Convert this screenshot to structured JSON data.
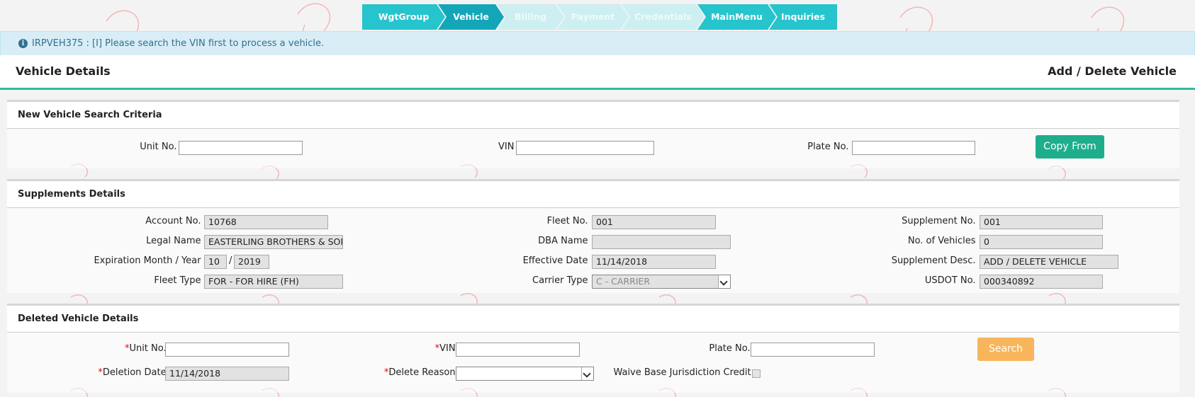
{
  "wizard": {
    "steps": [
      {
        "label": "WgtGroup",
        "state": "done"
      },
      {
        "label": "Vehicle",
        "state": "active"
      },
      {
        "label": "Billing",
        "state": "disabled"
      },
      {
        "label": "Payment",
        "state": "disabled"
      },
      {
        "label": "Credentials",
        "state": "disabled"
      },
      {
        "label": "MainMenu",
        "state": "done"
      },
      {
        "label": "Inquiries",
        "state": "done"
      }
    ]
  },
  "alert": {
    "icon": "info-icon",
    "message": "IRPVEH375 : [I] Please search the VIN first to process a vehicle."
  },
  "title": {
    "left": "Vehicle Details",
    "right": "Add / Delete Vehicle"
  },
  "search": {
    "heading": "New Vehicle Search Criteria",
    "unit_label": "Unit No. :",
    "unit_value": "",
    "vin_label": "VIN :",
    "vin_value": "",
    "plate_label": "Plate No. :",
    "plate_value": "",
    "copy_button": "Copy From"
  },
  "supplements": {
    "heading": "Supplements Details",
    "account_label": "Account No. :",
    "account_value": "10768",
    "fleet_label": "Fleet No. :",
    "fleet_value": "001",
    "supno_label": "Supplement No. :",
    "supno_value": "001",
    "legal_label": "Legal Name :",
    "legal_value": "EASTERLING BROTHERS & SON",
    "dba_label": "DBA Name :",
    "dba_value": "",
    "nveh_label": "No. of Vehicles :",
    "nveh_value": "0",
    "exp_label": "Expiration Month / Year :",
    "exp_month": "10",
    "exp_sep": "/",
    "exp_year": "2019",
    "eff_label": "Effective Date :",
    "eff_value": "11/14/2018",
    "supdesc_label": "Supplement Desc. :",
    "supdesc_value": "ADD / DELETE VEHICLE",
    "fleettype_label": "Fleet Type :",
    "fleettype_value": "FOR - FOR HIRE (FH)",
    "carrier_label": "Carrier Type :",
    "carrier_value": "C - CARRIER",
    "usdot_label": "USDOT No. :",
    "usdot_value": "000340892"
  },
  "deleted": {
    "heading": "Deleted Vehicle Details",
    "required_mark": "*",
    "unit_label": "Unit No.:",
    "unit_value": "",
    "vin_label": "VIN:",
    "vin_value": "",
    "plate_label": "Plate No.:",
    "plate_value": "",
    "search_button": "Search",
    "deldate_label": "Deletion Date:",
    "deldate_value": "11/14/2018",
    "reason_label": "Delete Reason:",
    "reason_value": "",
    "waive_label": "Waive Base Jurisdiction Credit:",
    "waive_checked": false
  },
  "colors": {
    "teal": "#26c4cc",
    "active": "#13a6b8",
    "green_button": "#1fae8c",
    "orange_button": "#f8b55b",
    "underline": "#2fb9a0"
  }
}
